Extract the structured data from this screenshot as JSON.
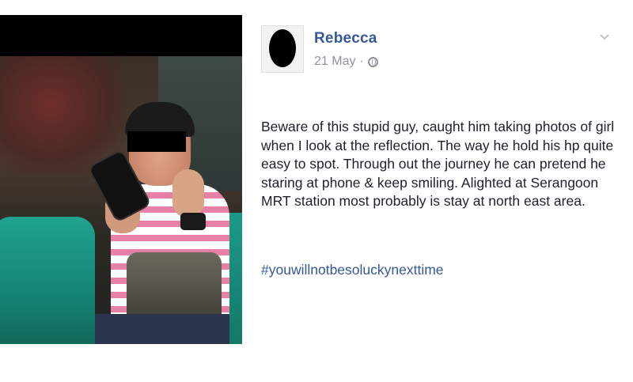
{
  "post": {
    "author": "Rebecca",
    "date": "21 May",
    "separator": "·",
    "privacy_icon": "globe-icon",
    "menu_icon": "chevron-down-icon",
    "body": "Beware of this stupid guy, caught him taking photos of girl when I look at the reflection. The way he hold his hp quite easy to spot. Through out the journey he can pretend he staring at phone & keep smiling. Alighted at Serangoon MRT station most probably is stay at north east area.",
    "hashtag": "#youwillnotbesoluckynexttime"
  },
  "colors": {
    "link": "#365899",
    "meta": "#90949c",
    "text": "#1d2129"
  }
}
